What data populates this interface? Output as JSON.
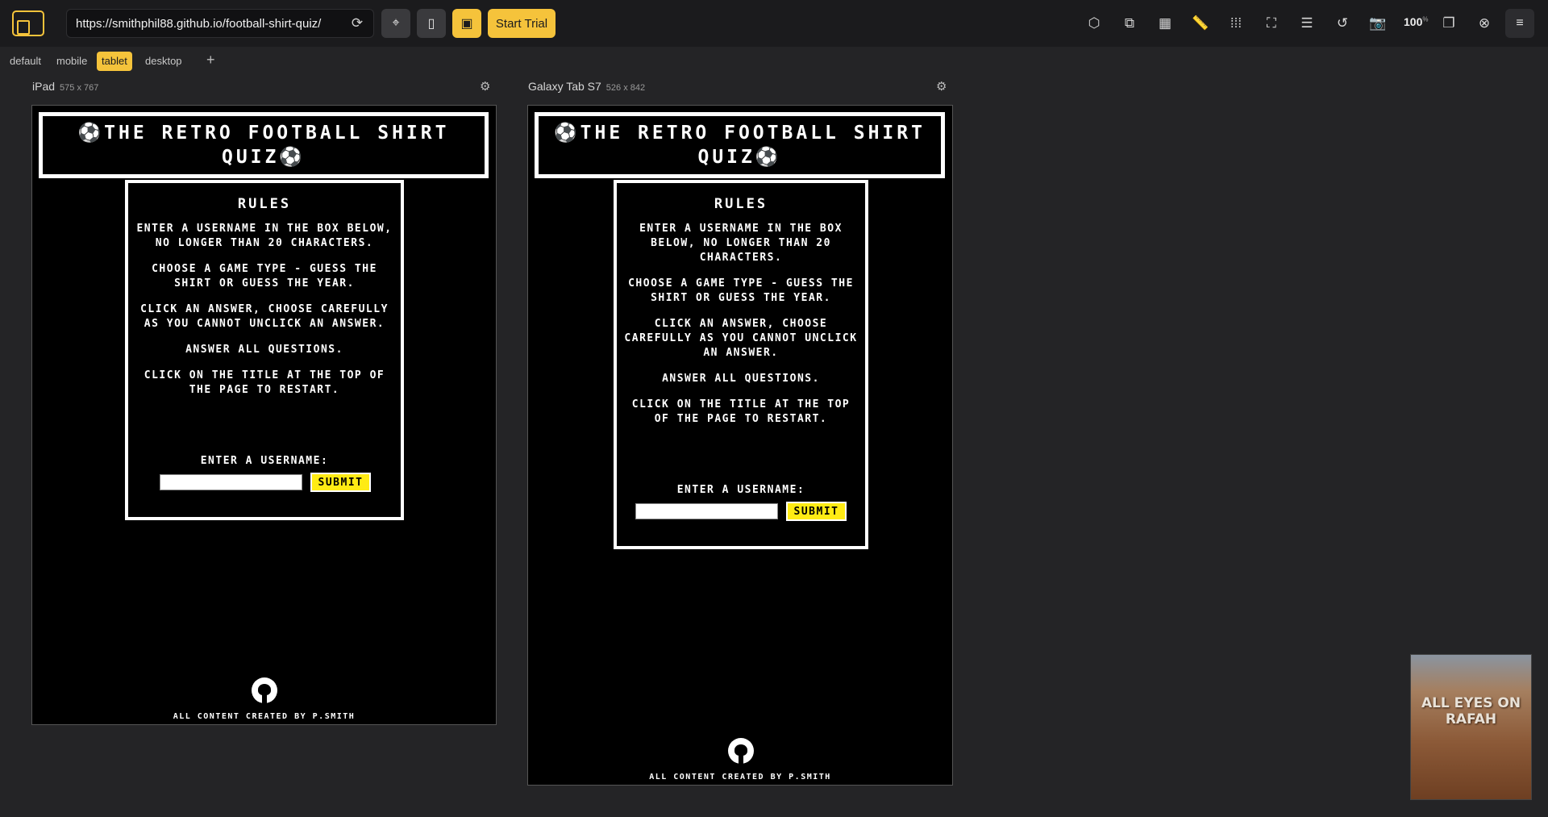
{
  "toolbar": {
    "url": "https://smithphil88.github.io/football-shirt-quiz/",
    "start_trial_label": "Start Trial",
    "zoom_value": "100",
    "zoom_unit": "%",
    "accent_color": "#f5c33b"
  },
  "view_tabs": [
    {
      "label": "default",
      "active": false
    },
    {
      "label": "mobile",
      "active": false
    },
    {
      "label": "tablet",
      "active": true
    },
    {
      "label": "desktop",
      "active": false
    }
  ],
  "add_tab_label": "+",
  "devices": [
    {
      "name": "iPad",
      "dims": "575 x 767"
    },
    {
      "name": "Galaxy Tab S7",
      "dims": "526 x 842"
    }
  ],
  "page": {
    "title": "⚽The Retro Football Shirt Quiz⚽",
    "rules_heading": "Rules",
    "rules": [
      "Enter a username in the box below, no longer than 20 characters.",
      "Choose a game type - Guess the shirt or guess the year.",
      "Click an answer, choose carefully as you cannot unclick an answer.",
      "Answer all questions.",
      "Click on the title at the top of the page to restart."
    ],
    "username_label": "Enter a username:",
    "submit_label": "Submit",
    "credit": "All content created by P.Smith"
  },
  "thumbnail": {
    "text": "ALL EYES ON RAFAH"
  }
}
